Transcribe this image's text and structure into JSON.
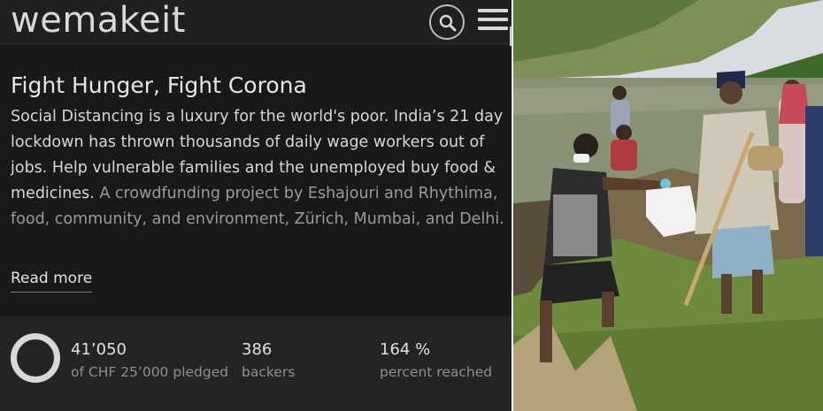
{
  "header": {
    "logo": "wemakeit",
    "search_icon": "search-icon",
    "menu_icon": "hamburger-menu-icon"
  },
  "project": {
    "title": "Fight Hunger, Fight Corona",
    "description_main": "Social Distancing is a luxury for the world's poor. India’s 21 day lockdown has thrown thousands of daily wage workers out of jobs. Help vulnerable families and the unemployed buy food & medicines.",
    "description_meta": "A crowdfunding project by Eshajouri and Rhythima, food, community, and environment, Zürich, Mumbai, and Delhi.",
    "read_more": "Read more"
  },
  "stats": {
    "progress_percent": 164,
    "pledged_value": "41’050",
    "pledged_label": "of CHF 25’000 pledged",
    "backers_value": "386",
    "backers_label": "backers",
    "percent_value": "164 %",
    "percent_label": "percent reached"
  },
  "colors": {
    "panel_bg": "#1b1b1b",
    "text_primary": "#e6e6e6",
    "text_muted": "#9a9a9a",
    "ring": "#d8d8d8"
  }
}
